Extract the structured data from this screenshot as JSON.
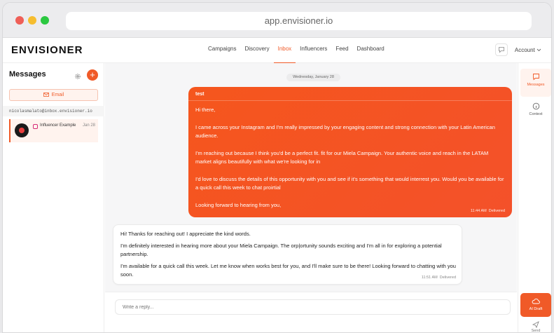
{
  "browser": {
    "url": "app.envisioner.io"
  },
  "nav": {
    "logo": "ENVISIONER",
    "links": [
      "Campaigns",
      "Discovery",
      "Inbox",
      "Influencers",
      "Feed",
      "Dashboard"
    ],
    "active_link": "Inbox",
    "account_label": "Account"
  },
  "sidebar": {
    "title": "Messages",
    "email_button": "Email",
    "inbox_address": "nicolasmalato@inbox.envisioner.io",
    "conversations": [
      {
        "name": "Influencer Example",
        "date": "Jan 28"
      }
    ]
  },
  "chat": {
    "date_chip": "Wednesday, January 28",
    "outgoing": {
      "subject": "test",
      "paragraphs": [
        "Hi there,",
        "I came across your Instagram and I'm really impressed by your engaging content and strong connection with your Latin American audience.",
        "I'm reaching out because I think you'd be a perfect fit. fit for our Miela Campaign. Your authentic voice and reach in the LATAM market aligns beautifully with what we're looking for in",
        "I'd love to discuss the details of this opportunity with you and see if it's something that would interrest you. Would you be available for a quick call this week to chat proirtial",
        "Looking forward to hearing from you,"
      ],
      "time": "11:44 AM",
      "status": "Delivered"
    },
    "incoming": {
      "paragraphs": [
        "Hi! Thanks for reaching out! I appreciate the kind words.",
        "I'm definitely interested in hearing more about your Miela Campaign. The orp|ortunity sounds exciting and I'm all in for exploring a potential partnership.",
        "I'm available for a quick call this week. Let me know when works best for you, and I'll make sure to be there! Looking forward to chatting with you soon."
      ],
      "time": "11:51 AM",
      "status": "Delivered"
    },
    "reply_placeholder": "Write a reply..."
  },
  "rightbar": {
    "messages_label": "Messages",
    "context_label": "Context",
    "ai_draft_label": "AI Draft",
    "send_label": "Send"
  },
  "colors": {
    "accent": "#f05a28"
  }
}
